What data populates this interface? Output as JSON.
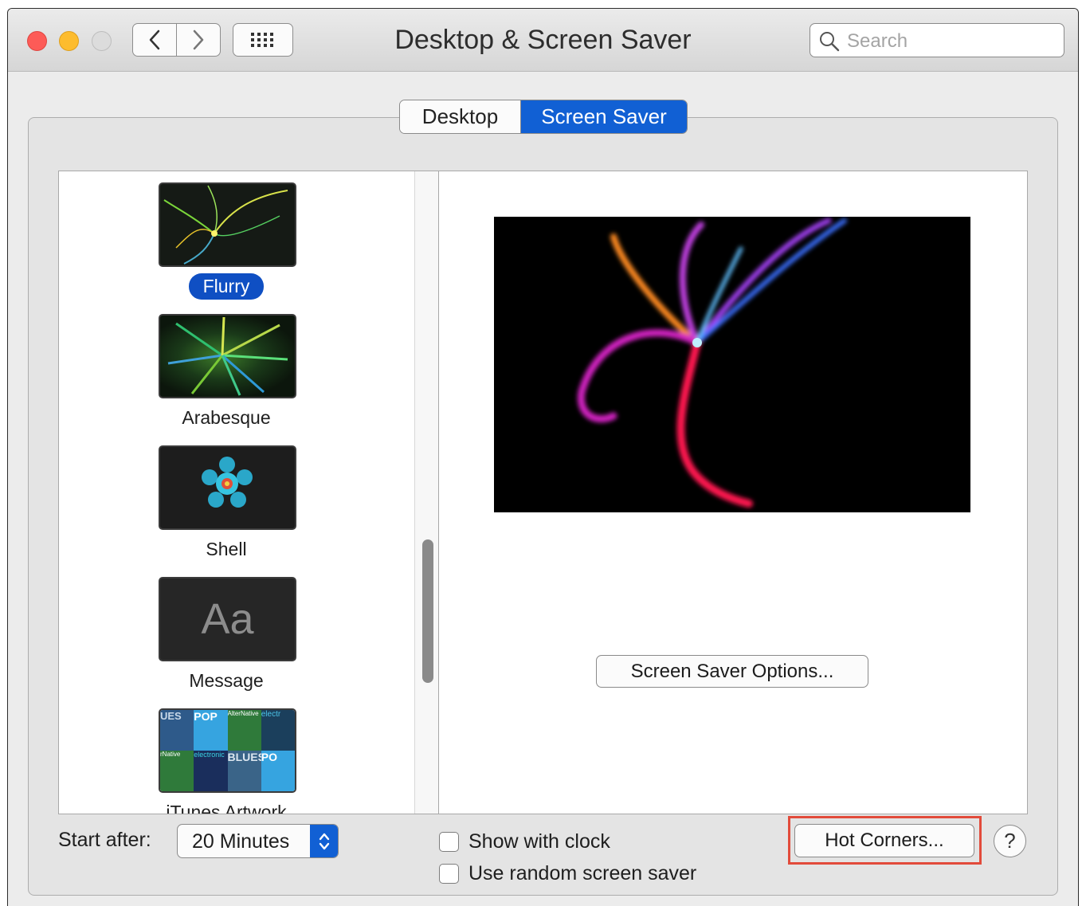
{
  "window": {
    "title": "Desktop & Screen Saver"
  },
  "search": {
    "placeholder": "Search"
  },
  "tabs": [
    {
      "label": "Desktop",
      "selected": false
    },
    {
      "label": "Screen Saver",
      "selected": true
    }
  ],
  "savers": [
    {
      "name": "Flurry",
      "selected": true
    },
    {
      "name": "Arabesque",
      "selected": false
    },
    {
      "name": "Shell",
      "selected": false
    },
    {
      "name": "Message",
      "selected": false,
      "thumb_text": "Aa"
    },
    {
      "name": "iTunes Artwork",
      "selected": false,
      "thumb_tiles": [
        "UES",
        "POP",
        "AlterNative",
        "electr",
        "rNative",
        "electronic",
        "BLUES",
        "PO"
      ]
    }
  ],
  "preview": {
    "options_label": "Screen Saver Options..."
  },
  "footer": {
    "start_after_label": "Start after:",
    "start_after_value": "20 Minutes",
    "show_clock_label": "Show with clock",
    "show_clock_checked": false,
    "random_label": "Use random screen saver",
    "random_checked": false,
    "hot_corners_label": "Hot Corners...",
    "help_label": "?"
  },
  "colors": {
    "accent": "#1160d4",
    "highlight_box": "#e24b3b"
  }
}
